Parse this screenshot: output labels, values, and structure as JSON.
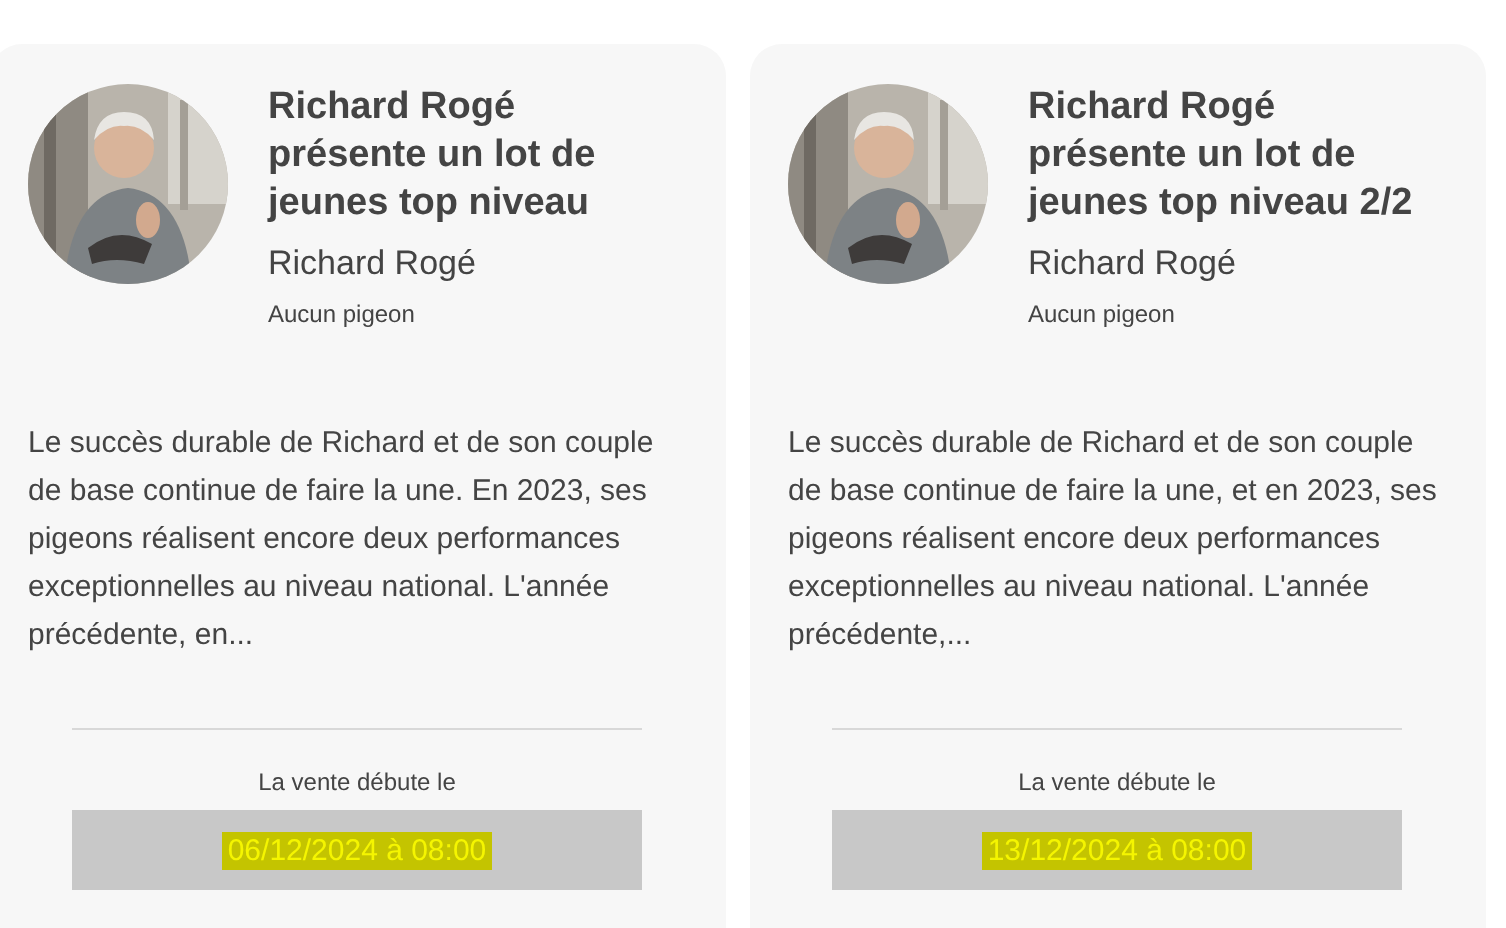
{
  "cards": [
    {
      "title": "Richard Rogé présente un lot de jeunes top niveau",
      "author": "Richard Rogé",
      "pigeons": "Aucun pigeon",
      "description": "Le succès durable de Richard et de son couple de base continue de faire la une. En 2023, ses pigeons réalisent encore deux performances exceptionnelles au niveau national. L'année précédente, en...",
      "sale_label": "La vente débute le",
      "sale_date": "06/12/2024 à 08:00",
      "highlighted": true
    },
    {
      "title": "Richard Rogé présente un lot de jeunes top niveau 2/2",
      "author": "Richard Rogé",
      "pigeons": "Aucun pigeon",
      "description": "Le succès durable de Richard et de son couple de base continue de faire la une, et en 2023, ses pigeons réalisent encore deux performances exceptionnelles au niveau national. L'année précédente,...",
      "sale_label": "La vente débute le",
      "sale_date": "13/12/2024 à 08:00",
      "highlighted": true
    }
  ]
}
